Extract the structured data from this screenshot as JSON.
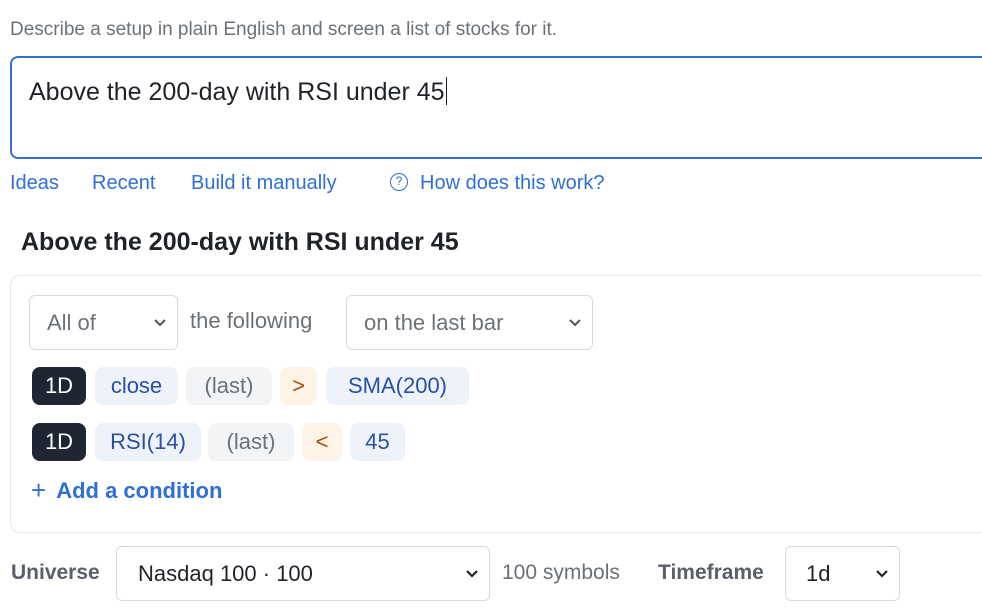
{
  "intro": "Describe a setup in plain English and screen a list of stocks for it.",
  "prompt": {
    "value": "Above the 200-day with RSI under 45"
  },
  "links": {
    "ideas": "Ideas",
    "recent": "Recent",
    "build_manually": "Build it manually",
    "help": "How does this work?"
  },
  "query_title": "Above the 200-day with RSI under 45",
  "builder": {
    "match_select": "All of",
    "following_text": "the following",
    "bar_select": "on the last bar",
    "conditions": [
      {
        "timeframe": "1D",
        "left": "close",
        "modifier": "(last)",
        "operator": ">",
        "right": "SMA(200)"
      },
      {
        "timeframe": "1D",
        "left": "RSI(14)",
        "modifier": "(last)",
        "operator": "<",
        "right": "45"
      }
    ],
    "add_condition": "Add a condition"
  },
  "footer": {
    "universe_label": "Universe",
    "universe_value": "Nasdaq 100 · 100",
    "symbols_count": "100 symbols",
    "timeframe_label": "Timeframe",
    "timeframe_value": "1d"
  },
  "colors": {
    "accent": "#2f6fd6",
    "timeframe_chip": "#1e2633",
    "metric_chip": "#eef3fb",
    "operator_chip": "#fdf3e6",
    "operator_text": "#b0490c"
  },
  "icons": [
    "help-circle-icon",
    "chevron-down-icon",
    "plus-icon"
  ]
}
